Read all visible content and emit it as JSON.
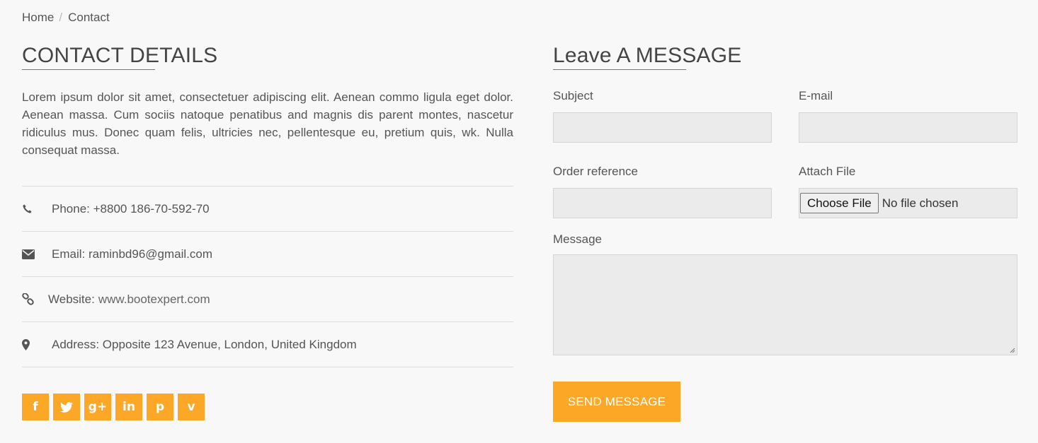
{
  "breadcrumb": {
    "home": "Home",
    "separator": "/",
    "current": "Contact"
  },
  "contact": {
    "heading": "CONTACT DETAILS",
    "intro": "Lorem ipsum dolor sit amet, consectetuer adipiscing elit. Aenean commo ligula eget dolor. Aenean massa. Cum sociis natoque penatibus and magnis dis parent montes, nascetur ridiculus mus. Donec quam felis, ultricies nec, pellentesque eu, pretium quis, wk. Nulla consequat massa.",
    "phone": "Phone: +8800 186-70-592-70",
    "email": "Email: raminbd96@gmail.com",
    "website_label": "Website: ",
    "website_link": "www.bootexpert.com",
    "address": "Address: Opposite 123 Avenue, London, United Kingdom"
  },
  "social": [
    {
      "icon": "facebook-icon",
      "glyph": "f"
    },
    {
      "icon": "twitter-icon",
      "glyph": "t"
    },
    {
      "icon": "google-plus-icon",
      "glyph": "g+"
    },
    {
      "icon": "linkedin-icon",
      "glyph": "in"
    },
    {
      "icon": "pinterest-icon",
      "glyph": "p"
    },
    {
      "icon": "vimeo-icon",
      "glyph": "v"
    }
  ],
  "form": {
    "heading": "Leave A MESSAGE",
    "subject_label": "Subject",
    "email_label": "E-mail",
    "order_label": "Order reference",
    "attach_label": "Attach File",
    "choose_file": "Choose File",
    "no_file": "No file chosen",
    "message_label": "Message",
    "send": "SEND MESSAGE"
  },
  "colors": {
    "accent": "#fda726",
    "background": "#f8f8f8",
    "input_bg": "#ebebeb"
  }
}
